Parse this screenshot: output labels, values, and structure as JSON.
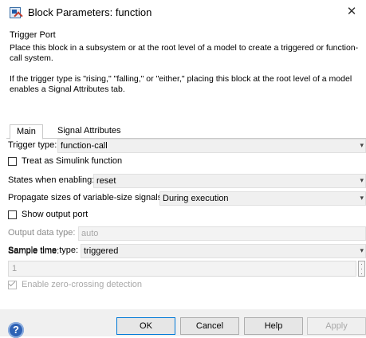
{
  "window": {
    "title": "Block Parameters: function",
    "close_glyph": "✕",
    "icon": "simulink-block-icon"
  },
  "section_title": "Trigger Port",
  "description": {
    "para1": "Place this block in a subsystem or at the root level of a model to create a triggered or function-call system.",
    "para2": "If the trigger type is \"rising,\" \"falling,\" or \"either,\" placing this block at the root level of a model enables a Signal Attributes tab."
  },
  "tabs": [
    {
      "label": "Main",
      "active": true
    },
    {
      "label": "Signal Attributes",
      "active": false
    }
  ],
  "params": {
    "trigger_type": {
      "label": "Trigger type:",
      "value": "function-call"
    },
    "treat_simulink": {
      "label": "Treat as Simulink function",
      "checked": false
    },
    "states_enabling": {
      "label": "States when enabling:",
      "value": "reset"
    },
    "propagate_sizes": {
      "label": "Propagate sizes of variable-size signals:",
      "value": "During execution"
    },
    "show_output_port": {
      "label": "Show output port",
      "checked": false
    },
    "output_data_type": {
      "label": "Output data type:",
      "value": "auto",
      "enabled": false
    },
    "sample_time_type": {
      "label": "Sample time type:",
      "value": "triggered"
    },
    "sample_time": {
      "label": "Sample time:",
      "value": "1",
      "enabled": false
    },
    "zero_crossing": {
      "label": "Enable zero-crossing detection",
      "checked": true,
      "enabled": false
    }
  },
  "footer": {
    "help_icon": "help-question-icon",
    "help_glyph": "?",
    "ok": "OK",
    "cancel": "Cancel",
    "help": "Help",
    "apply": "Apply"
  }
}
